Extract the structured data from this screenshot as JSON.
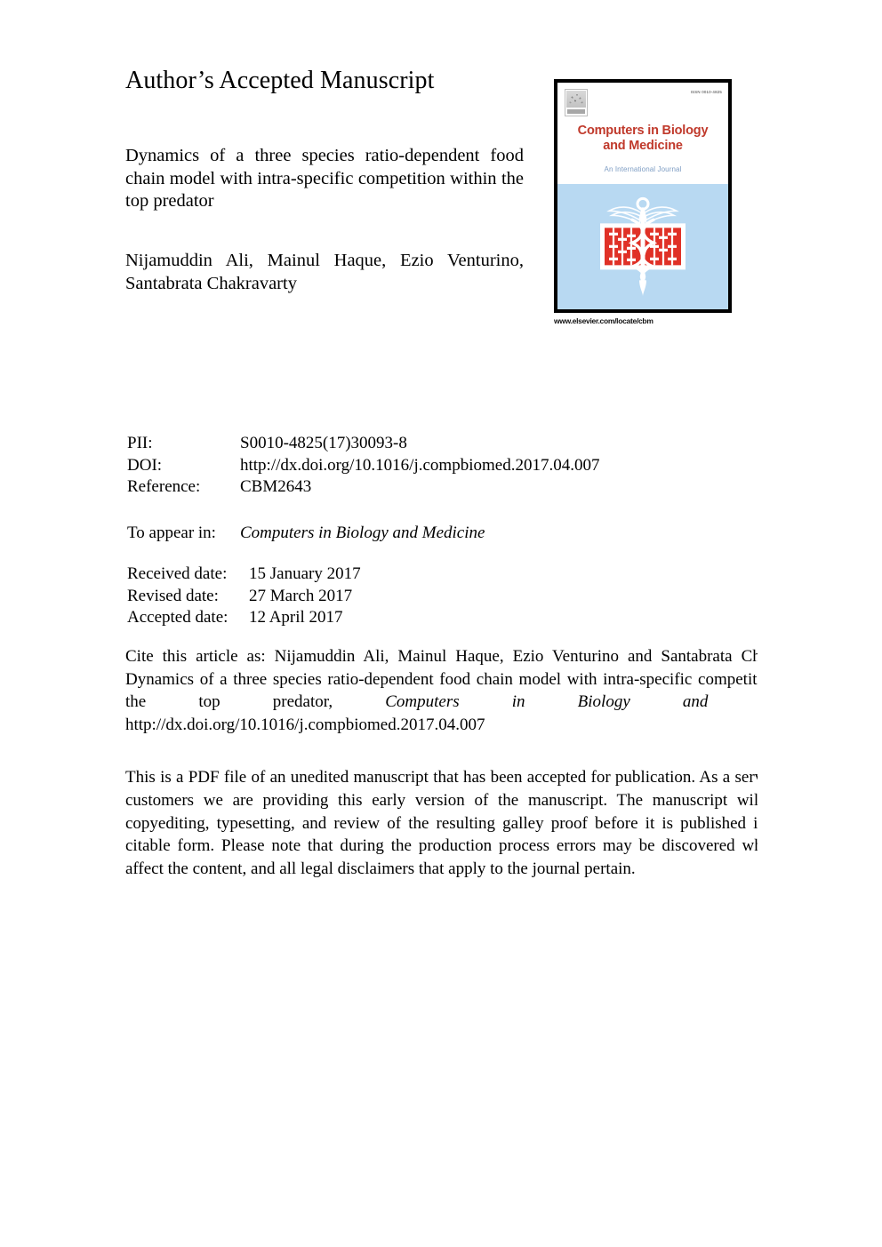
{
  "header": {
    "aam_label": "Author’s Accepted Manuscript"
  },
  "article": {
    "title": "Dynamics of a three species ratio-dependent food chain model with intra-specific competition within the top predator",
    "authors_line1": "Nijamuddin Ali, Mainul Haque, Ezio Venturino,",
    "authors_line2": "Santabrata Chakravarty"
  },
  "cover": {
    "issn": "ISSN 0010-4825",
    "journal_title_line1": "Computers in Biology",
    "journal_title_line2": "and Medicine",
    "subtitle": "An International Journal",
    "url": "www.elsevier.com/locate/cbm",
    "publisher_logo": "elsevier-tree-logo",
    "emblem": "caduceus-abacus-emblem",
    "colors": {
      "title_red": "#c0392b",
      "subtitle_blue": "#7f9ec4",
      "panel_blue": "#b8d9f2",
      "abacus_red": "#e03127",
      "border_black": "#000000"
    }
  },
  "metadata": {
    "rows": [
      {
        "label": "PII:",
        "value": "S0010-4825(17)30093-8"
      },
      {
        "label": "DOI:",
        "value": "http://dx.doi.org/10.1016/j.compbiomed.2017.04.007"
      },
      {
        "label": "Reference:",
        "value": "CBM2643"
      }
    ]
  },
  "appear_in": {
    "label": "To appear in:",
    "journal": "Computers in Biology and Medicine"
  },
  "dates": {
    "rows": [
      {
        "label": "Received date:",
        "value": "15 January 2017"
      },
      {
        "label": "Revised date:",
        "value": "27 March 2017"
      },
      {
        "label": "Accepted date:",
        "value": "12 April 2017"
      }
    ]
  },
  "citation": {
    "prefix": "Cite this article as: Nijamuddin Ali, Mainul Haque, Ezio Venturino and Santabrata Chakravarty, Dynamics of a three species ratio-dependent food chain model with intra-specific competition within the top predator, ",
    "journal_italic": "Computers in Biology and Medicine",
    "suffix": ", http://dx.doi.org/10.1016/j.compbiomed.2017.04.007"
  },
  "disclaimer": {
    "text": "This is a PDF file of an unedited manuscript that has been accepted for publication. As a service to our customers we are providing this early version of the manuscript. The manuscript will undergo copyediting, typesetting, and review of the resulting galley proof before it is published in its final citable form. Please note that during the production process errors may be discovered which could affect the content, and all legal disclaimers that apply to the journal pertain."
  }
}
